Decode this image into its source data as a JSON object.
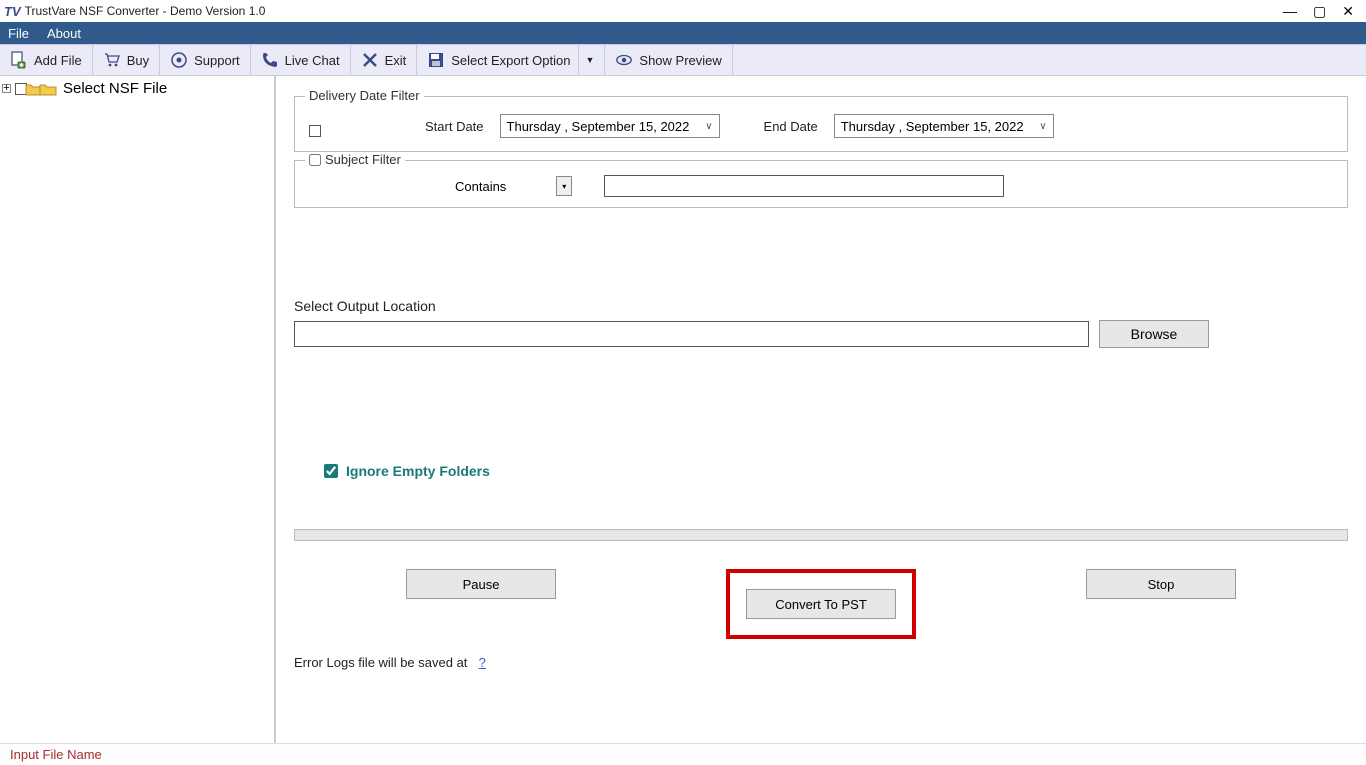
{
  "window": {
    "title": "TrustVare NSF Converter - Demo Version 1.0",
    "logo_text": "TV"
  },
  "menu": {
    "file": "File",
    "about": "About"
  },
  "toolbar": {
    "add_file": "Add File",
    "buy": "Buy",
    "support": "Support",
    "live_chat": "Live Chat",
    "exit": "Exit",
    "export_option": "Select Export Option",
    "show_preview": "Show Preview"
  },
  "sidebar": {
    "root_label": "Select NSF File"
  },
  "filters": {
    "delivery_legend": "Delivery Date Filter",
    "start_label": "Start Date",
    "end_label": "End Date",
    "start_value": "Thursday , September 15, 2022",
    "end_value": "Thursday , September 15, 2022",
    "subject_legend": "Subject Filter",
    "contains_label": "Contains",
    "contains_value": ""
  },
  "output": {
    "label": "Select Output Location",
    "path": "",
    "browse": "Browse"
  },
  "options": {
    "ignore_empty": "Ignore Empty Folders",
    "ignore_checked": true
  },
  "actions": {
    "pause": "Pause",
    "convert": "Convert To PST",
    "stop": "Stop"
  },
  "errlog": {
    "prefix": "Error Logs file will be saved at",
    "link": "?"
  },
  "status": {
    "text": "Input File Name"
  }
}
